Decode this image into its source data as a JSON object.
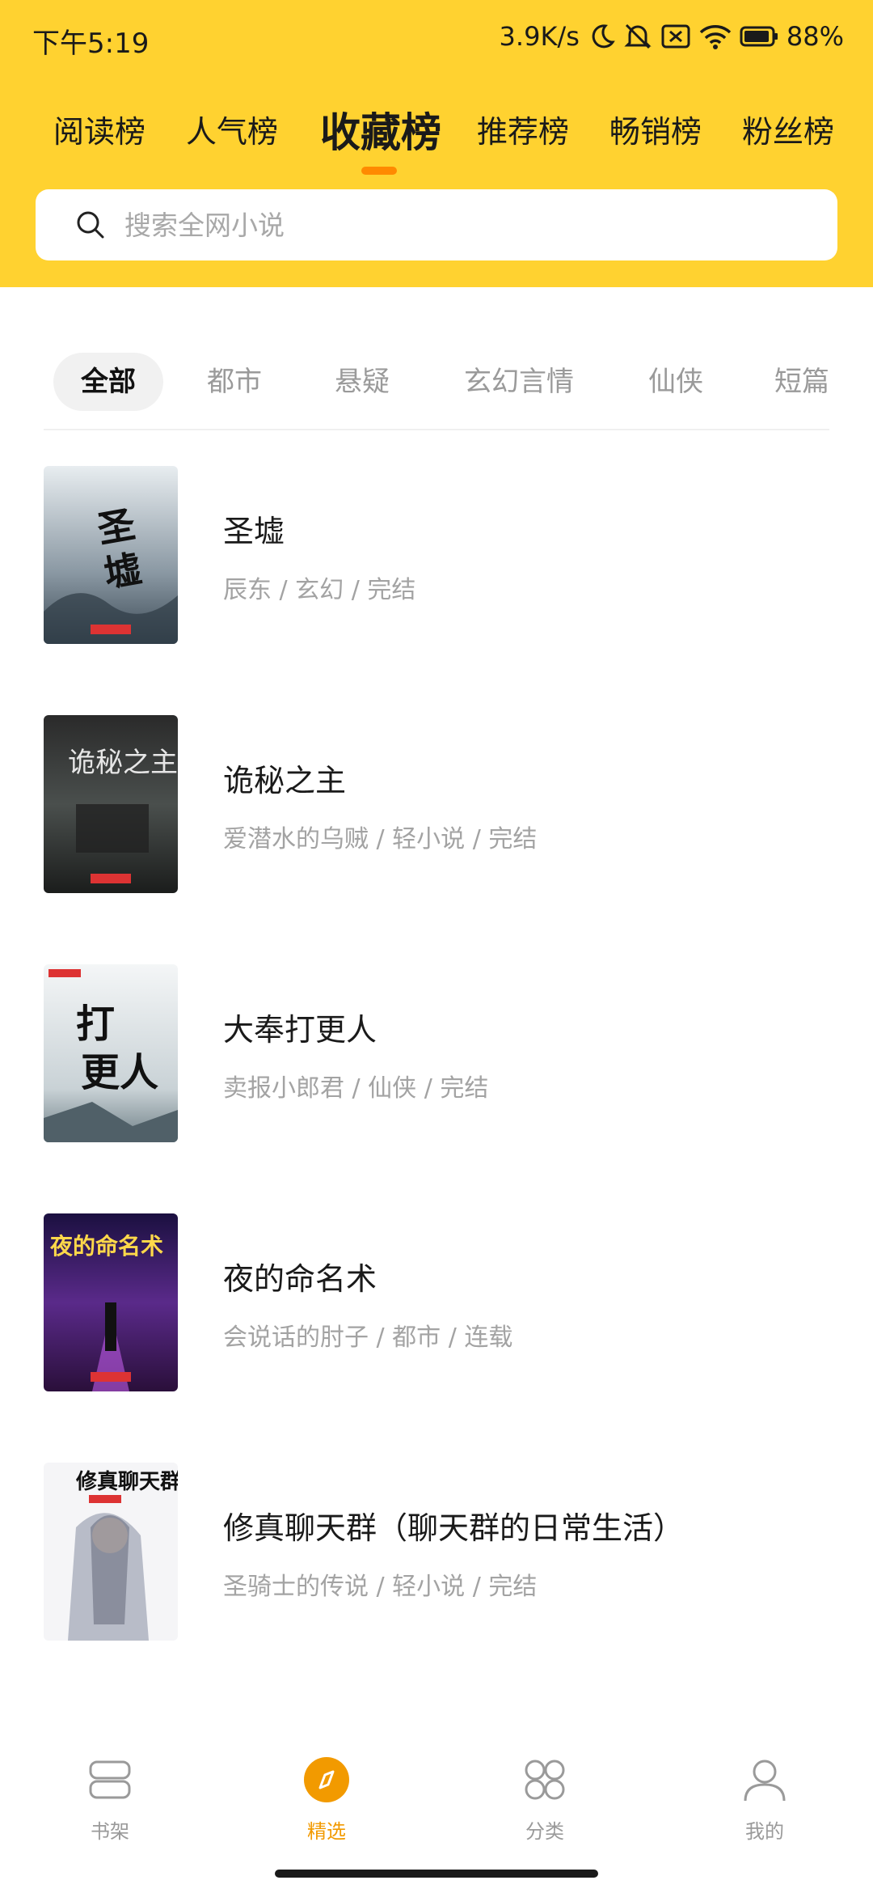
{
  "status_bar": {
    "time": "下午5:19",
    "speed": "3.9K/s",
    "battery": "88%"
  },
  "rank_tabs": [
    {
      "label": "阅读榜",
      "active": false
    },
    {
      "label": "人气榜",
      "active": false
    },
    {
      "label": "收藏榜",
      "active": true
    },
    {
      "label": "推荐榜",
      "active": false
    },
    {
      "label": "畅销榜",
      "active": false
    },
    {
      "label": "粉丝榜",
      "active": false
    }
  ],
  "search": {
    "placeholder": "搜索全网小说"
  },
  "genres": [
    {
      "label": "全部",
      "active": true
    },
    {
      "label": "都市",
      "active": false
    },
    {
      "label": "悬疑",
      "active": false
    },
    {
      "label": "玄幻言情",
      "active": false
    },
    {
      "label": "仙侠",
      "active": false
    },
    {
      "label": "短篇",
      "active": false
    }
  ],
  "books": [
    {
      "title": "圣墟",
      "meta": "辰东 / 玄幻 / 完结",
      "cover_icon": "sheng-xu-cover"
    },
    {
      "title": "诡秘之主",
      "meta": "爱潜水的乌贼 / 轻小说 / 完结",
      "cover_icon": "gui-mi-zhi-zhu-cover"
    },
    {
      "title": "大奉打更人",
      "meta": "卖报小郎君 / 仙侠 / 完结",
      "cover_icon": "da-feng-cover"
    },
    {
      "title": "夜的命名术",
      "meta": "会说话的肘子 / 都市 / 连载",
      "cover_icon": "ye-de-ming-ming-shu-cover"
    },
    {
      "title": "修真聊天群（聊天群的日常生活）",
      "meta": "圣骑士的传说 / 轻小说 / 完结",
      "cover_icon": "xiu-zhen-cover"
    }
  ],
  "bottom_nav": [
    {
      "label": "书架",
      "icon": "bookshelf-icon",
      "active": false
    },
    {
      "label": "精选",
      "icon": "compass-icon",
      "active": true
    },
    {
      "label": "分类",
      "icon": "category-icon",
      "active": false
    },
    {
      "label": "我的",
      "icon": "profile-icon",
      "active": false
    }
  ],
  "colors": {
    "header_bg": "#FFD230",
    "accent": "#FF8A00",
    "nav_active": "#F29A00"
  }
}
